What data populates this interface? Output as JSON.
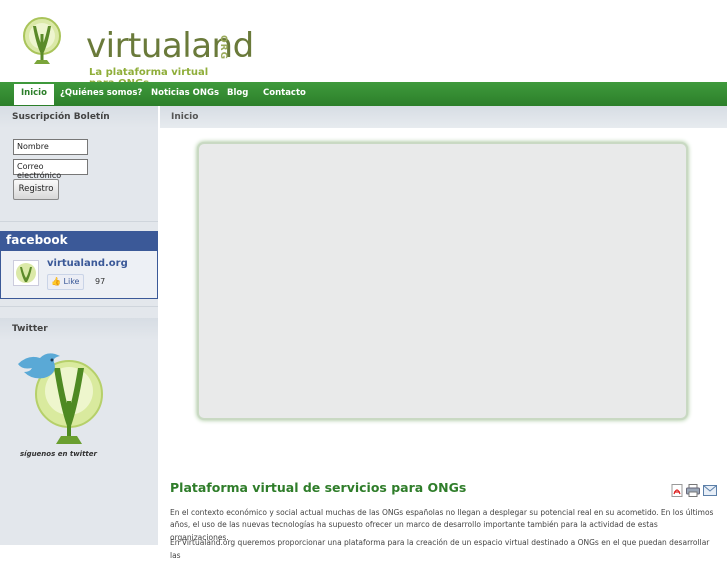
{
  "header": {
    "brand": "virtualand",
    "brand_suffix": "ORG",
    "tagline": "La plataforma virtual para ONGs",
    "logo_icon": "v-plant-logo-icon",
    "colors": {
      "brand_text": "#6a7a3a",
      "tagline": "#8fae3a",
      "nav_green": "#3f9a3c"
    }
  },
  "nav": {
    "items": [
      {
        "label": "Inicio",
        "active": true
      },
      {
        "label": "¿Quiénes somos?"
      },
      {
        "label": "Noticias ONGs"
      },
      {
        "label": "Blog"
      },
      {
        "label": "Contacto"
      }
    ]
  },
  "sidebar": {
    "newsletter": {
      "title": "Suscripción Boletín",
      "name_value": "Nombre",
      "email_value": "Correo electrónico",
      "submit_label": "Registro"
    },
    "facebook": {
      "brand": "facebook",
      "page_name": "virtualand.org",
      "like_label": "Like",
      "like_count": "97",
      "brand_color": "#3b5998"
    },
    "twitter": {
      "title": "Twitter",
      "caption": "síguenos en twitter",
      "image_icon": "twitter-bird-logo-icon"
    }
  },
  "main": {
    "section_title": "Inicio",
    "article": {
      "title": "Plataforma virtual de servicios para ONGs",
      "icons": [
        "pdf-icon",
        "print-icon",
        "email-icon"
      ],
      "paragraphs": [
        "En el contexto económico y social actual muchas de las ONGs españolas no llegan a desplegar su potencial real en su acometido. En los últimos",
        "años, el uso de las nuevas tecnologías ha supuesto ofrecer un marco de desarrollo importante también para la actividad de estas organizaciones.",
        "En Virtualand.org queremos proporcionar una plataforma para la creación de un espacio virtual destinado a ONGs en el que puedan desarrollar las"
      ]
    }
  }
}
